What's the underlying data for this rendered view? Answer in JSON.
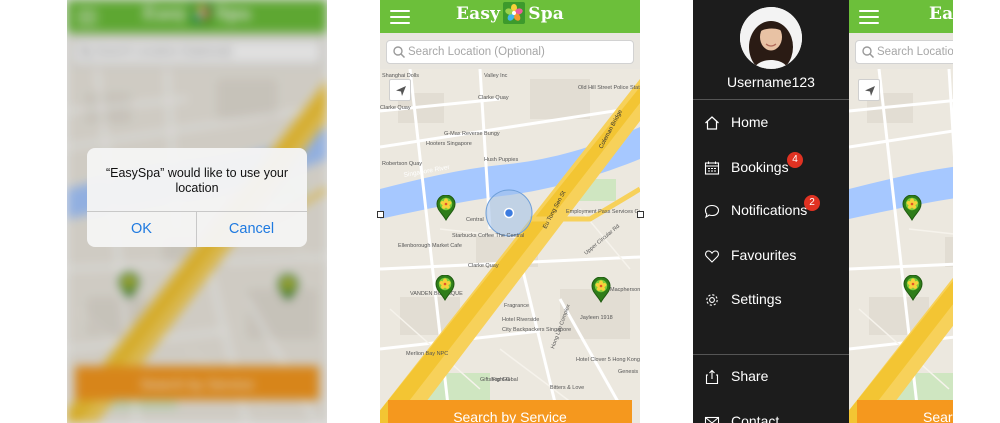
{
  "app": {
    "brand_left": "Easy",
    "brand_right": "Spa",
    "brand_color": "#6cbf3a",
    "cta_color": "#f5981e"
  },
  "search": {
    "placeholder": "Search Location (Optional)",
    "partial_placeholder": "Search Location"
  },
  "cta": {
    "label": "Search by Service",
    "partial_label": "Search"
  },
  "alert": {
    "message": "“EasySpa” would like to use your location",
    "ok_label": "OK",
    "cancel_label": "Cancel"
  },
  "map": {
    "labels": [
      "Shanghai Dolls",
      "Valley Inc",
      "Old Hill Street Police Station",
      "Clarke Quay",
      "Clarke Quay",
      "Hooters Singapore",
      "G-Max Reverse Bungy",
      "Robertson Quay",
      "Singapore River",
      "Hush Puppies",
      "Central",
      "Starbucks Coffee The Central",
      "Clarke Quay",
      "Ellenborough Market Cafe",
      "VANDEN BOUTIQUE",
      "Employment Pass Services Centre",
      "Eu Tong Sen St",
      "Coleman Bridge",
      "Macpherson Barbeque Seafood",
      "Upper Circular Rd",
      "Fragrance",
      "Hotel Riverside",
      "City Backpackers Singapore",
      "Jayleen 1918",
      "Hong Lim Complex",
      "Hotel Clover 5 Hong Kong Street",
      "Merlion Bay NPC",
      "Giftshop Global",
      "Bitters & Love",
      "Genesis",
      "Fight G"
    ]
  },
  "drawer": {
    "username": "Username123",
    "items": [
      {
        "label": "Home",
        "icon": "home-icon"
      },
      {
        "label": "Bookings",
        "icon": "calendar-icon",
        "badge": "4"
      },
      {
        "label": "Notifications",
        "icon": "speech-bubble-icon",
        "badge": "2"
      },
      {
        "label": "Favourites",
        "icon": "heart-icon"
      },
      {
        "label": "Settings",
        "icon": "gear-icon"
      }
    ],
    "bottom_items": [
      {
        "label": "Share",
        "icon": "share-icon"
      },
      {
        "label": "Contact",
        "icon": "envelope-icon"
      }
    ]
  }
}
